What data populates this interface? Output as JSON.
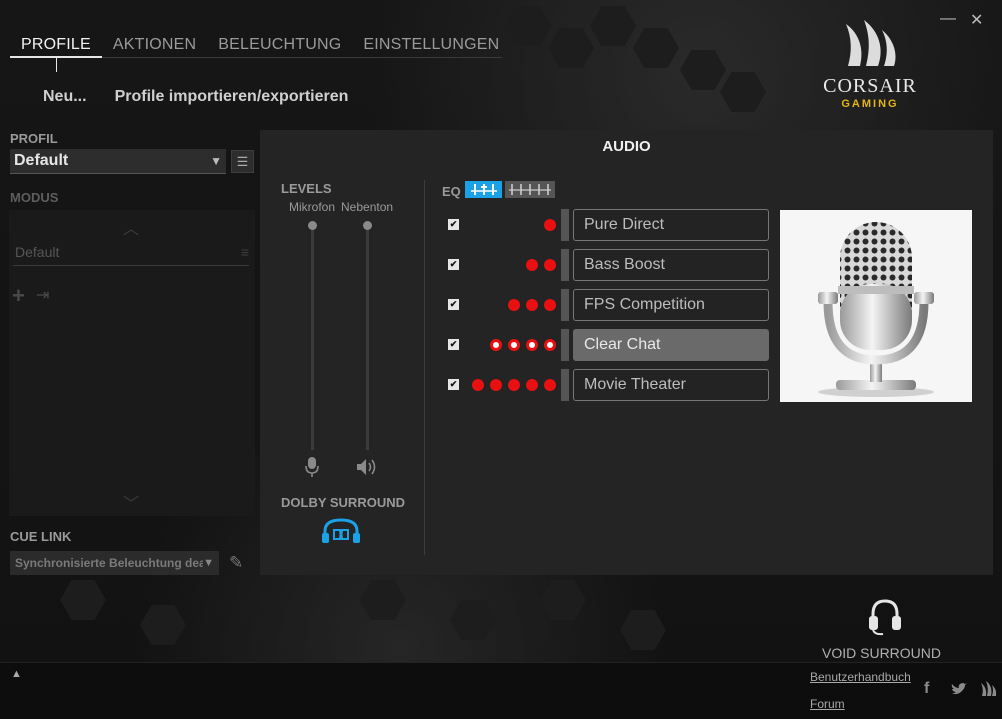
{
  "window": {
    "minimize_label": "—",
    "close_label": "✕"
  },
  "tabs": [
    {
      "label": "PROFILE",
      "active": true
    },
    {
      "label": "AKTIONEN",
      "active": false
    },
    {
      "label": "BELEUCHTUNG",
      "active": false
    },
    {
      "label": "EINSTELLUNGEN",
      "active": false
    }
  ],
  "sub_actions": {
    "new_label": "Neu...",
    "import_export_label": "Profile importieren/exportieren"
  },
  "logo": {
    "brand": "CORSAIR",
    "sub": "GAMING",
    "brand_color": "#e3b51a"
  },
  "sidebar": {
    "profile_label": "PROFIL",
    "profile_value": "Default",
    "modus_label": "MODUS",
    "modus_item": "Default",
    "cue_link_label": "CUE LINK",
    "cue_link_value": "Synchronisierte Beleuchtung dea"
  },
  "audio": {
    "title": "AUDIO",
    "levels_label": "LEVELS",
    "mic_label": "Mikrofon",
    "sidetone_label": "Nebenton",
    "mic_level": 1.0,
    "sidetone_level": 1.0,
    "dolby_label": "DOLBY SURROUND",
    "eq_label": "EQ",
    "accent_color": "#1aa1e6",
    "presets": [
      {
        "label": "Pure Direct",
        "checked": true,
        "dots": 1,
        "selected": false
      },
      {
        "label": "Bass Boost",
        "checked": true,
        "dots": 2,
        "selected": false
      },
      {
        "label": "FPS Competition",
        "checked": true,
        "dots": 3,
        "selected": false
      },
      {
        "label": "Clear Chat",
        "checked": true,
        "dots": 4,
        "selected": true
      },
      {
        "label": "Movie Theater",
        "checked": true,
        "dots": 5,
        "selected": false
      }
    ],
    "preset_image_icon": "microphone-image"
  },
  "footer": {
    "void_label": "VOID SURROUND",
    "manual_link": "Benutzerhandbuch",
    "forum_link": "Forum",
    "facebook_label": "f"
  }
}
